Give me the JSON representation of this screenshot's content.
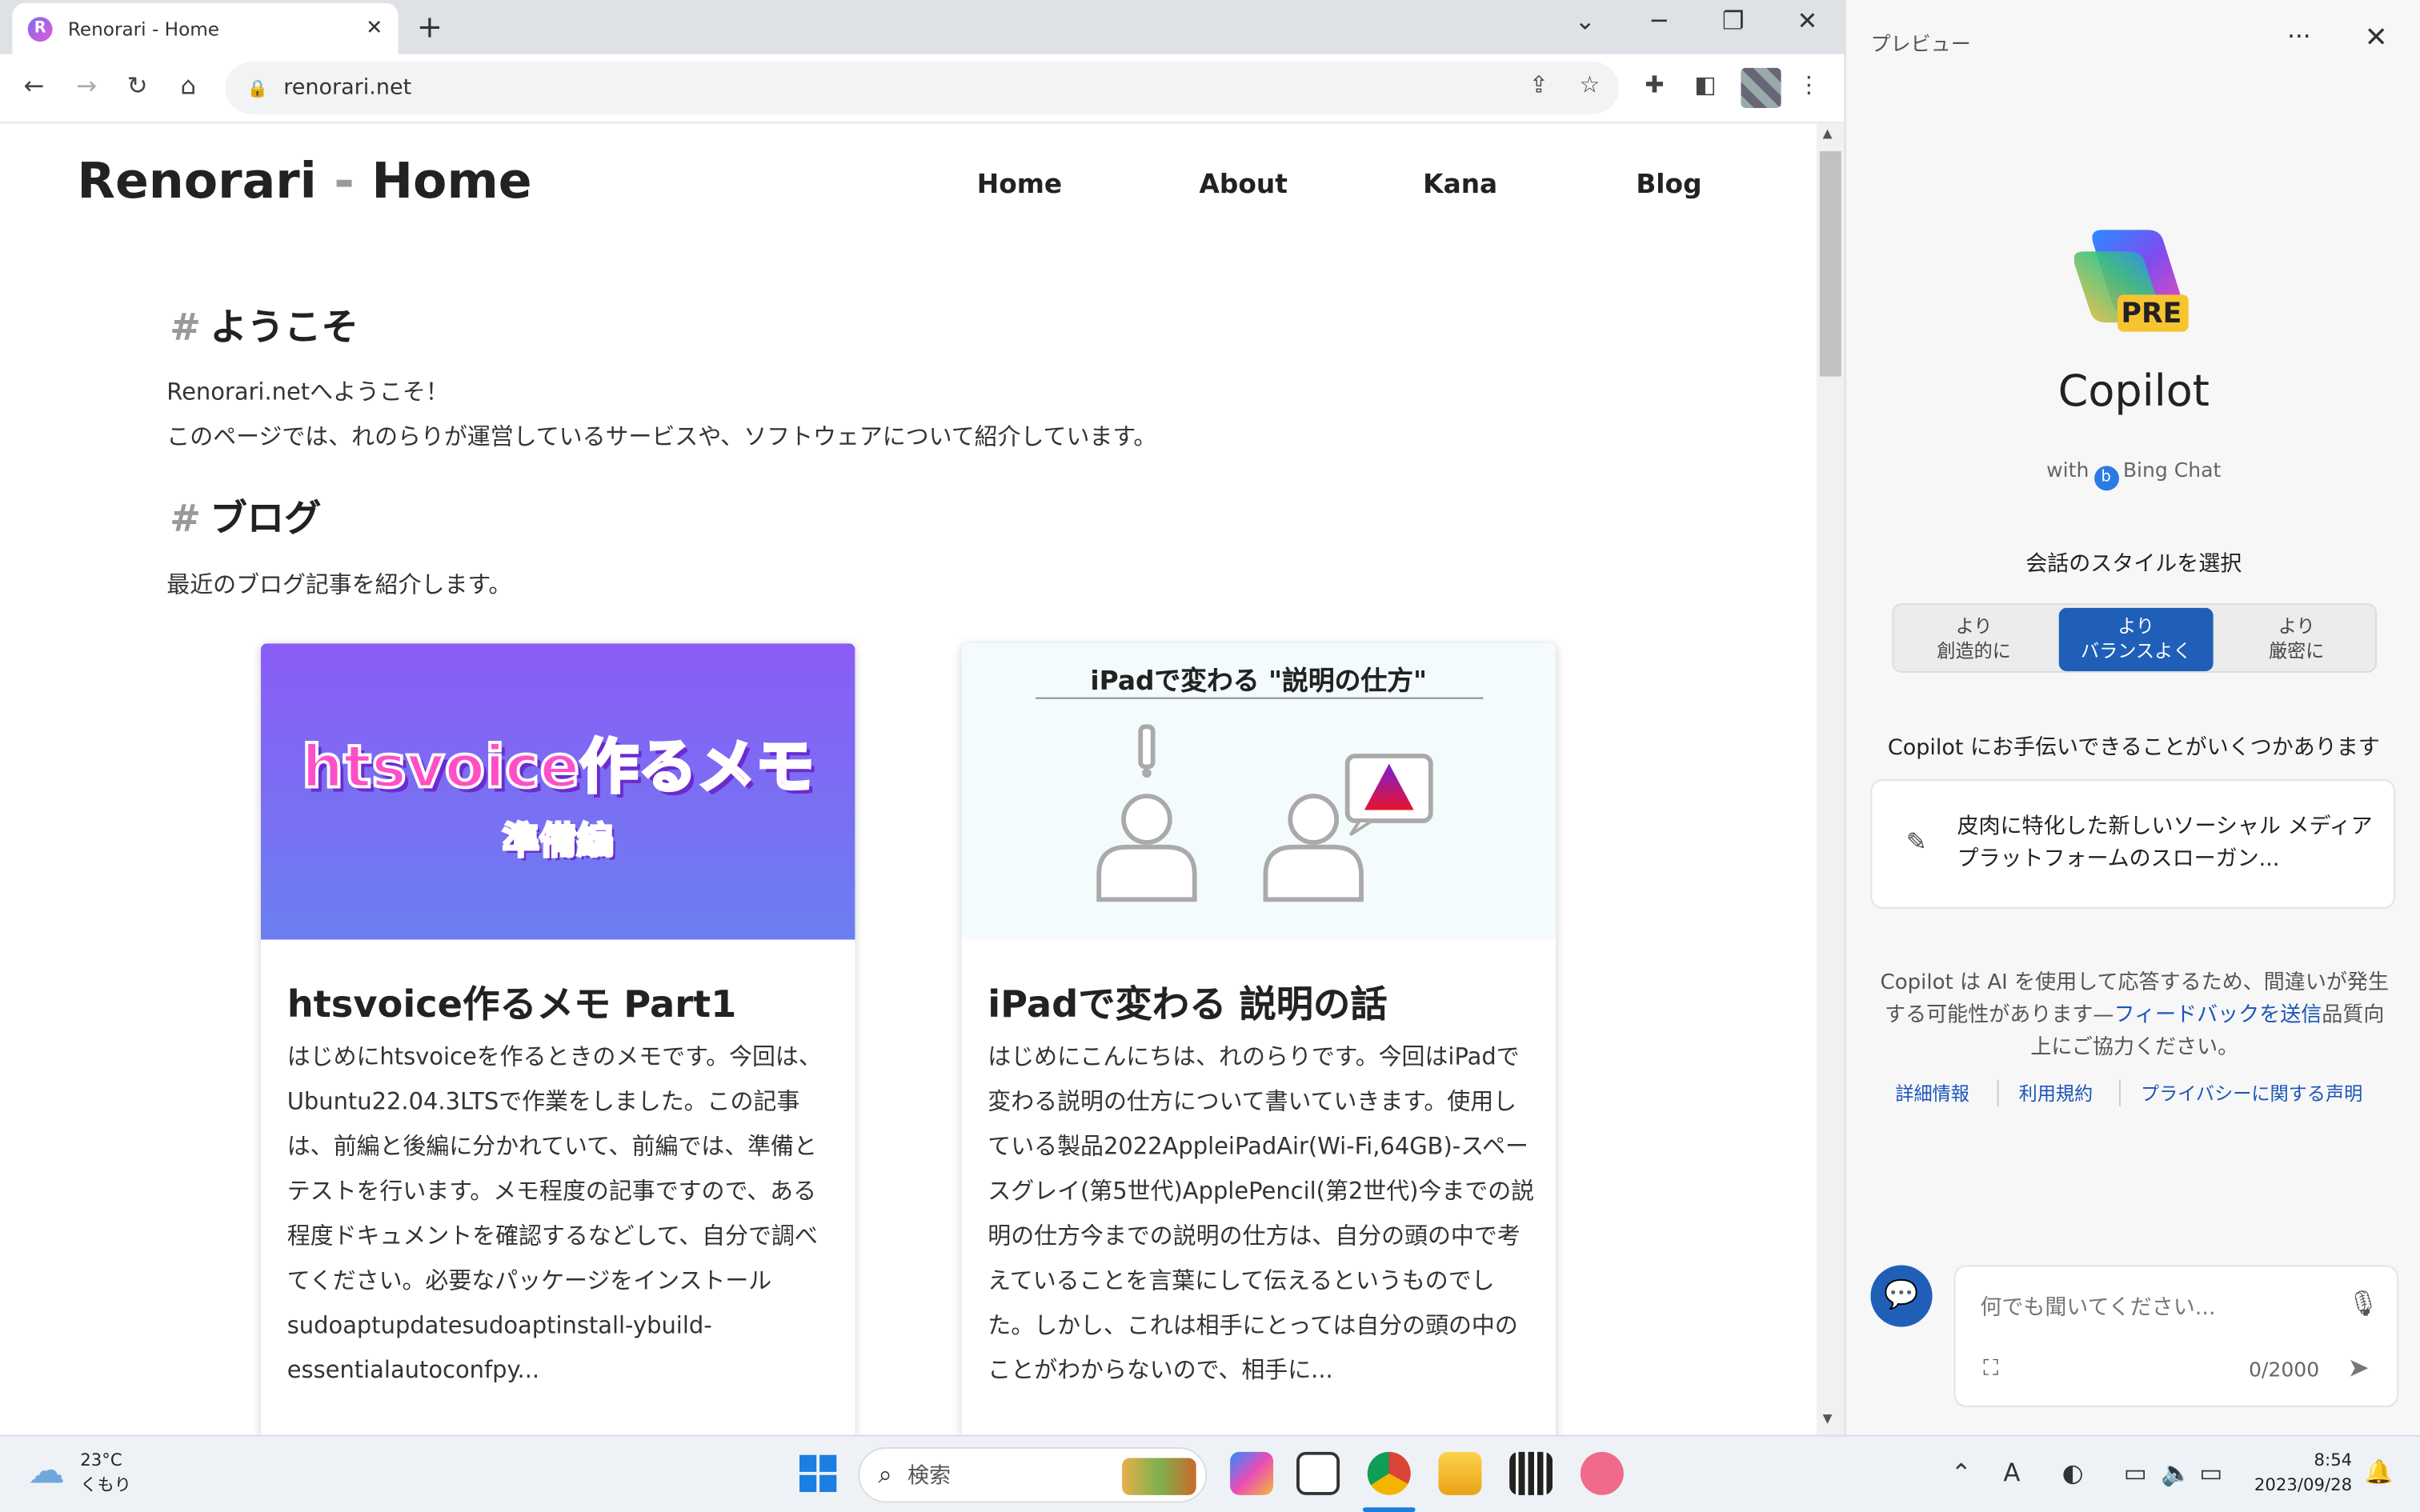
{
  "browser": {
    "tab_title": "Renorari - Home",
    "tab_close": "✕",
    "new_tab": "+",
    "url": "renorari.net",
    "window_controls": {
      "dropdown": "⌄",
      "minimize": "─",
      "restore": "❐",
      "close": "✕"
    }
  },
  "site": {
    "title_left": "Renorari",
    "title_sep": " - ",
    "title_right": "Home",
    "nav": [
      "Home",
      "About",
      "Kana",
      "Blog"
    ],
    "welcome_heading": "ようこそ",
    "welcome_line1": "Renorari.netへようこそ！",
    "welcome_line2": "このページでは、れのらりが運営しているサービスや、ソフトウェアについて紹介しています。",
    "blog_heading": "ブログ",
    "blog_intro": "最近のブログ記事を紹介します。",
    "hash": "#",
    "cards": [
      {
        "image_text_main": "htsvoice作るメモ",
        "image_text_sub": "準備編",
        "title": "htsvoice作るメモ Part1",
        "body": "はじめにhtsvoiceを作るときのメモです。今回は、Ubuntu22.04.3LTSで作業をしました。この記事は、前編と後編に分かれていて、前編では、準備とテストを行います。メモ程度の記事ですので、ある程度ドキュメントを確認するなどして、自分で調べてください。必要なパッケージをインストールsudoaptupdatesudoaptinstall-ybuild-essentialautoconfpy..."
      },
      {
        "image_text_main": "iPadで変わる \"説明の仕方\"",
        "title": "iPadで変わる 説明の話",
        "body": "はじめにこんにちは、れのらりです。今回はiPadで変わる説明の仕方について書いていきます。使用している製品2022AppleiPadAir(Wi-Fi,64GB)-スペースグレイ(第5世代)ApplePencil(第2世代)今までの説明の仕方今までの説明の仕方は、自分の頭の中で考えていることを言葉にして伝えるというものでした。しかし、これは相手にとっては自分の頭の中のことがわからないので、相手に..."
      }
    ]
  },
  "copilot": {
    "panel_title": "プレビュー",
    "more": "···",
    "close": "✕",
    "logo_badge": "PRE",
    "name": "Copilot",
    "with_prefix": "with",
    "with_suffix": "Bing Chat",
    "style_prompt": "会話のスタイルを選択",
    "styles": [
      {
        "line1": "より",
        "line2": "創造的に",
        "selected": false
      },
      {
        "line1": "より",
        "line2": "バランスよく",
        "selected": true
      },
      {
        "line1": "より",
        "line2": "厳密に",
        "selected": false
      }
    ],
    "help_text": "Copilot にお手伝いできることがいくつかあります",
    "suggestion": "皮肉に特化した新しいソーシャル メディア プラットフォームのスローガン...",
    "disclaimer_pre": "Copilot は AI を使用して応答するため、間違いが発生する可能性があります—",
    "disclaimer_link": "フィードバックを送信",
    "disclaimer_post": "品質向上にご協力ください。",
    "links": [
      "詳細情報",
      "利用規約",
      "プライバシーに関する声明"
    ],
    "input_placeholder": "何でも聞いてください...",
    "char_count": "0/2000",
    "colors": {
      "accent": "#1f5fb8"
    }
  },
  "taskbar": {
    "temperature": "23°C",
    "weather": "くもり",
    "search_placeholder": "検索",
    "time": "8:54",
    "date": "2023/09/28",
    "tray_ime": "A"
  }
}
